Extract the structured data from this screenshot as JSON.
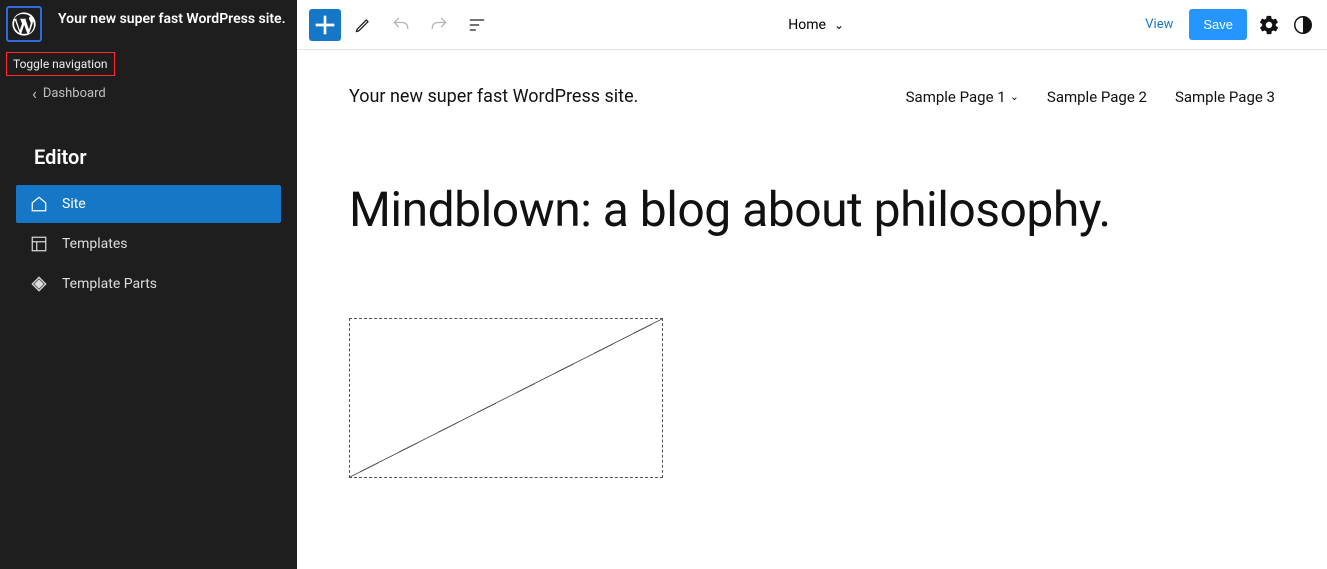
{
  "sidebar": {
    "site_name": "Your new super fast WordPress site.",
    "toggle_label": "Toggle navigation",
    "dashboard_label": "Dashboard",
    "panel_title": "Editor",
    "items": [
      {
        "label": "Site"
      },
      {
        "label": "Templates"
      },
      {
        "label": "Template Parts"
      }
    ]
  },
  "toolbar": {
    "doc_label": "Home",
    "view_label": "View",
    "save_label": "Save"
  },
  "page": {
    "site_title": "Your new super fast WordPress site.",
    "nav": [
      {
        "label": "Sample Page 1",
        "has_children": true
      },
      {
        "label": "Sample Page 2",
        "has_children": false
      },
      {
        "label": "Sample Page 3",
        "has_children": false
      }
    ],
    "headline": "Mindblown: a blog about philosophy."
  }
}
